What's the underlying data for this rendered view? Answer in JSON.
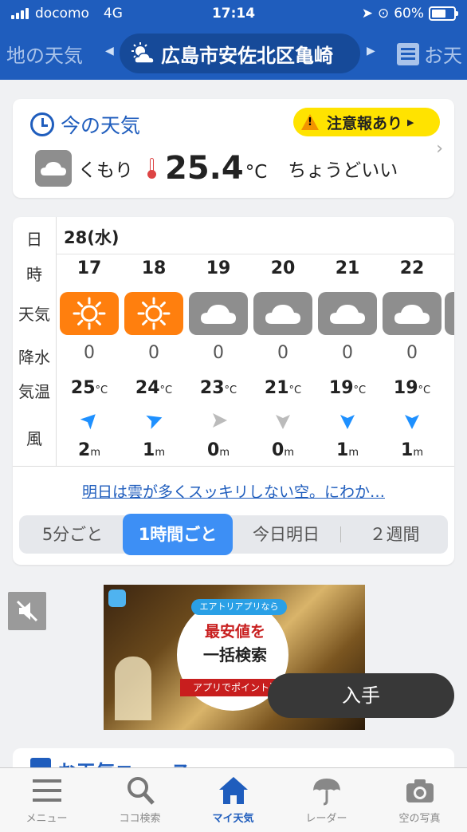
{
  "status_bar": {
    "carrier": "docomo",
    "network": "4G",
    "time": "17:14",
    "battery": "60%"
  },
  "location_bar": {
    "prev_label": "地の天気",
    "current_location": "広島市安佐北区亀崎",
    "next_label": "お天",
    "current_icon": "sun-behind-cloud-icon"
  },
  "now_weather": {
    "title": "今の天気",
    "warning": "注意報あり",
    "condition": "くもり",
    "condition_icon": "cloud-icon",
    "temperature": "25.4",
    "unit": "°C",
    "comment": "ちょうどいい"
  },
  "forecast": {
    "row_labels": {
      "day": "日",
      "hour": "時",
      "weather": "天気",
      "precip": "降水",
      "temp": "気温",
      "wind": "風"
    },
    "date": "28(水)",
    "temp_unit": "°C",
    "wind_unit": "m",
    "hours": [
      {
        "hour": "17",
        "weather": "sunny",
        "icon": "sun-icon",
        "precip": "0",
        "temp": "25",
        "wind_speed": "2",
        "wind_dir_deg": 45,
        "wind_color": "#1e90ff"
      },
      {
        "hour": "18",
        "weather": "sunny",
        "icon": "sun-icon",
        "precip": "0",
        "temp": "24",
        "wind_speed": "1",
        "wind_dir_deg": 70,
        "wind_color": "#1e90ff"
      },
      {
        "hour": "19",
        "weather": "cloudy",
        "icon": "cloud-icon",
        "precip": "0",
        "temp": "23",
        "wind_speed": "0",
        "wind_dir_deg": 90,
        "wind_color": "#bbbbbb"
      },
      {
        "hour": "20",
        "weather": "cloudy",
        "icon": "cloud-icon",
        "precip": "0",
        "temp": "21",
        "wind_speed": "0",
        "wind_dir_deg": 180,
        "wind_color": "#bbbbbb"
      },
      {
        "hour": "21",
        "weather": "cloudy",
        "icon": "cloud-icon",
        "precip": "0",
        "temp": "19",
        "wind_speed": "1",
        "wind_dir_deg": 180,
        "wind_color": "#1e90ff"
      },
      {
        "hour": "22",
        "weather": "cloudy",
        "icon": "cloud-icon",
        "precip": "0",
        "temp": "19",
        "wind_speed": "1",
        "wind_dir_deg": 180,
        "wind_color": "#1e90ff"
      }
    ],
    "summary_link": "明日は雲が多くスッキリしない空。にわか…",
    "tabs": [
      {
        "label": "5分ごと",
        "active": false
      },
      {
        "label": "1時間ごと",
        "active": true
      },
      {
        "label": "今日明日",
        "active": false
      },
      {
        "label": "２週間",
        "active": false
      }
    ]
  },
  "ad": {
    "badge": "エアトリアプリなら",
    "line1": "最安値を",
    "line2": "一括検索",
    "line3": "アプリでポイント還",
    "cta": "入手"
  },
  "peek_card": {
    "title": "お天気ニュース"
  },
  "bottom_nav": [
    {
      "label": "メニュー",
      "icon": "menu-icon",
      "active": false
    },
    {
      "label": "ココ検索",
      "icon": "search-icon",
      "active": false
    },
    {
      "label": "マイ天気",
      "icon": "home-icon",
      "active": true
    },
    {
      "label": "レーダー",
      "icon": "umbrella-icon",
      "active": false
    },
    {
      "label": "空の写真",
      "icon": "camera-icon",
      "active": false
    }
  ],
  "colors": {
    "brand_blue": "#1f5dbd",
    "sunny": "#ff7f0e",
    "cloudy": "#8e8e8e",
    "warning": "#ffe300",
    "tab_active": "#3d8ff5"
  }
}
